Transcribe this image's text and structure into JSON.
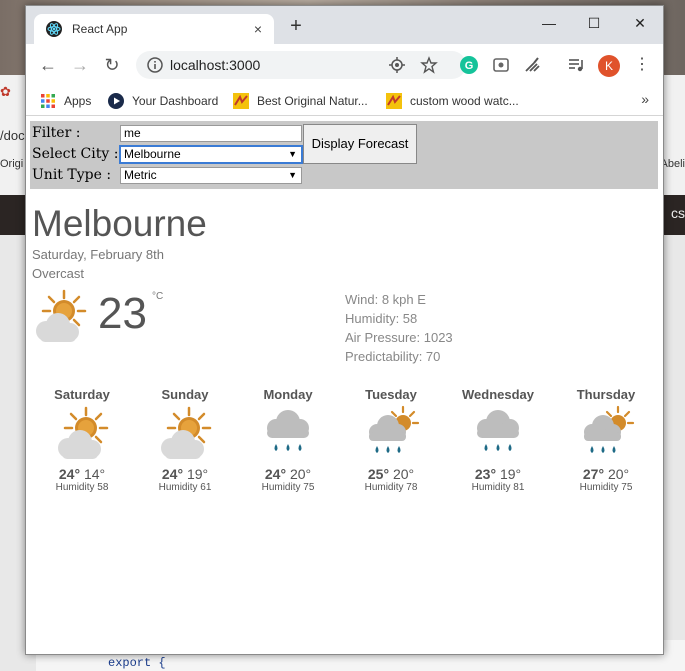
{
  "background": {
    "left_snippets": [
      "/doc",
      "Origi"
    ],
    "right_snippet": "Abeli",
    "right_dark": "cs",
    "code_line": "export {"
  },
  "browser": {
    "tab_title": "React App",
    "tab_close": "×",
    "new_tab": "+",
    "url": "localhost:3000",
    "profile_initial": "K",
    "controls": {
      "minimize": "—",
      "maximize": "☐",
      "close": "✕"
    },
    "nav": {
      "back": "←",
      "forward": "→",
      "reload": "↻"
    },
    "bookmarks": [
      {
        "label": "Apps",
        "icon": "apps-grid-icon"
      },
      {
        "label": "Your Dashboard",
        "icon": "play-icon"
      },
      {
        "label": "Best Original Natur...",
        "icon": "bookmark-site-icon"
      },
      {
        "label": "custom wood watc...",
        "icon": "bookmark-site-icon"
      }
    ],
    "bookmarks_more": "»"
  },
  "app": {
    "filter_label": "Filter :",
    "filter_value": "me",
    "city_label": "Select City :",
    "city_value": "Melbourne",
    "unit_label": "Unit Type :",
    "unit_value": "Metric",
    "button_label": "Display Forecast",
    "city": "Melbourne",
    "date": "Saturday, February 8th",
    "condition": "Overcast",
    "current_temp": "23",
    "temp_unit": "°C",
    "details": {
      "wind": "Wind: 8 kph E",
      "humidity": "Humidity: 58",
      "pressure": "Air Pressure: 1023",
      "predictability": "Predictability: 70"
    },
    "forecast": [
      {
        "day": "Saturday",
        "high": "24°",
        "low": "14°",
        "humidity_label": "Humidity",
        "humidity": "58",
        "icon": "partly-cloudy-sun-icon"
      },
      {
        "day": "Sunday",
        "high": "24°",
        "low": "19°",
        "humidity_label": "Humidity",
        "humidity": "61",
        "icon": "partly-cloudy-sun-icon"
      },
      {
        "day": "Monday",
        "high": "24°",
        "low": "20°",
        "humidity_label": "Humidity",
        "humidity": "75",
        "icon": "rain-cloud-icon"
      },
      {
        "day": "Tuesday",
        "high": "25°",
        "low": "20°",
        "humidity_label": "Humidity",
        "humidity": "78",
        "icon": "sun-rain-cloud-icon"
      },
      {
        "day": "Wednesday",
        "high": "23°",
        "low": "19°",
        "humidity_label": "Humidity",
        "humidity": "81",
        "icon": "rain-cloud-icon"
      },
      {
        "day": "Thursday",
        "high": "27°",
        "low": "20°",
        "humidity_label": "Humidity",
        "humidity": "75",
        "icon": "sun-rain-cloud-icon"
      }
    ]
  }
}
